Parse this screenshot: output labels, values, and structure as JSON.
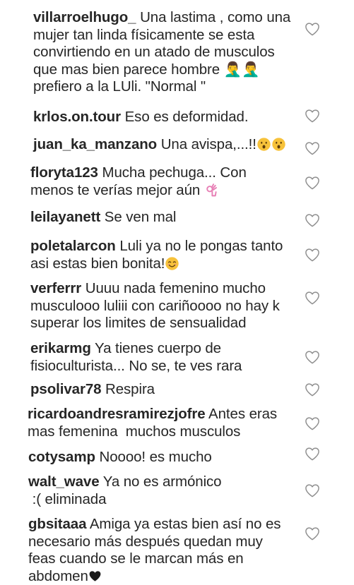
{
  "comments": [
    {
      "username": "villarroelhugo_",
      "text": "Una lastima , como una\nmujer tan linda físicamente se esta\nconvirtiendo en un atado de musculos\nque mas bien parece hombre 🤦‍♂️🤦‍♂️\nprefiero a la LUli. \"Normal \"",
      "emoji": ""
    },
    {
      "username": "krlos.on.tour",
      "text": "Eso es deformidad.",
      "emoji": ""
    },
    {
      "username": "juan_ka_manzano",
      "text": "Una avispa,...!!",
      "emoji": "😮😮"
    },
    {
      "username": "floryta123",
      "text": "Mucha pechuga... Con\nmenos te verías mejor aún ",
      "emoji": "👌"
    },
    {
      "username": "leilayanett",
      "text": "Se ven mal",
      "emoji": ""
    },
    {
      "username": "poletalarcon",
      "text": "Luli ya no le pongas tanto\nasi estas bien bonita!",
      "emoji": "😊"
    },
    {
      "username": "verferrr",
      "text": "Uuuu nada femenino mucho\nmusculooo luliii con cariñoooo no hay k\nsuperar los limites de sensualidad",
      "emoji": ""
    },
    {
      "username": "erikarmg",
      "text": "Ya tienes cuerpo de\nfisioculturista... No se, te ves rara",
      "emoji": ""
    },
    {
      "username": "psolivar78",
      "text": "Respira",
      "emoji": ""
    },
    {
      "username": "ricardoandresramirezjofre",
      "text": "Antes eras\nmas femenina  muchos musculos",
      "emoji": ""
    },
    {
      "username": "cotysamp",
      "text": "Noooo! es mucho",
      "emoji": ""
    },
    {
      "username": "walt_wave",
      "text": "Ya no es armónico\n :( eliminada",
      "emoji": ""
    },
    {
      "username": "gbsitaaa",
      "text": "Amiga ya estas bien así no es\nnecesario más después quedan muy\nfeas cuando se le marcan más en\nabdomen",
      "emoji": "❤"
    }
  ],
  "colors": {
    "text": "#262626",
    "heart_stroke": "#8e8e8e",
    "emoji_yellow": "#F7C23A",
    "emoji_pink": "#E77FB5",
    "emoji_heart": "#1a1a1a"
  },
  "icons": {
    "like": "heart-outline-icon"
  }
}
